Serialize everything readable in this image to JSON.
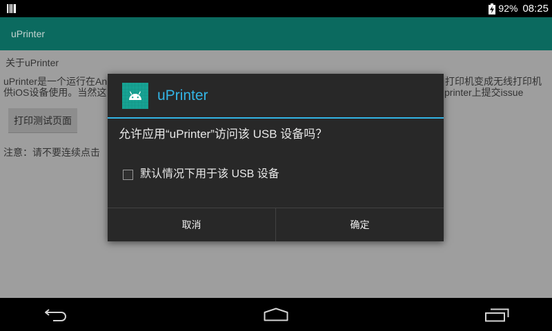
{
  "status_bar": {
    "notification_icon": "barcode-icon",
    "battery_icon": "battery-charging-icon",
    "battery_percent": "92%",
    "time": "08:25"
  },
  "action_bar": {
    "title": "uPrinter"
  },
  "main": {
    "heading": "关于uPrinter",
    "description_lines": [
      {
        "start": "uPrinter是一个运行在An",
        "end": "打印机变成无线打印机"
      },
      {
        "start": "供iOS设备使用。当然这",
        "end": "printer上提交issue"
      }
    ],
    "test_page_button": "打印测试页面",
    "notice": "注意：请不要连续点击"
  },
  "dialog": {
    "app_icon": "android-app-icon",
    "title": "uPrinter",
    "message": "允许应用“uPrinter”访问该 USB 设备吗？",
    "checkbox": {
      "label": "默认情况下用于该 USB 设备",
      "checked": false
    },
    "cancel_label": "取消",
    "ok_label": "确定"
  },
  "nav_bar": {
    "back_icon": "back-icon",
    "home_icon": "home-icon",
    "recents_icon": "recents-icon"
  },
  "colors": {
    "status_bar": "#000000",
    "action_bar": "#0b6a5f",
    "content_background": "#9e9e9e",
    "dialog_background": "#282828",
    "accent": "#33b5e5",
    "nav_bar": "#000000"
  }
}
